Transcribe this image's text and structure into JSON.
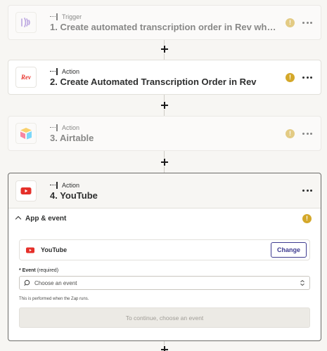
{
  "steps": [
    {
      "kind": "Trigger",
      "title": "1. Create automated transcription order in Rev when upd…",
      "app": "rev-audio",
      "state": "dim"
    },
    {
      "kind": "Action",
      "title": "2. Create Automated Transcription Order in Rev",
      "app": "rev",
      "state": "active"
    },
    {
      "kind": "Action",
      "title": "3. Airtable",
      "app": "airtable",
      "state": "dim"
    }
  ],
  "expanded_step": {
    "kind": "Action",
    "title": "4. YouTube",
    "section_label": "App & event",
    "app_name": "YouTube",
    "change_label": "Change",
    "event_label": "Event",
    "event_required": "(required)",
    "event_placeholder": "Choose an event",
    "helper_text": "This is performed when the Zap runs.",
    "continue_label": "To continue, choose an event"
  },
  "warning_symbol": "!",
  "rev_logo_text": "Rev",
  "colors": {
    "warning": "#d4a82a",
    "rev_red": "#e8322b",
    "youtube_red": "#e5302a",
    "change_border": "#3d3a8f",
    "rev_wave": "#8a63d2"
  },
  "icons": [
    "audio-wave-icon",
    "rev-logo-icon",
    "airtable-logo-icon",
    "youtube-logo-icon",
    "warning-icon",
    "more-icon",
    "plus-icon",
    "chevron-up-icon",
    "search-icon",
    "sort-icon"
  ]
}
